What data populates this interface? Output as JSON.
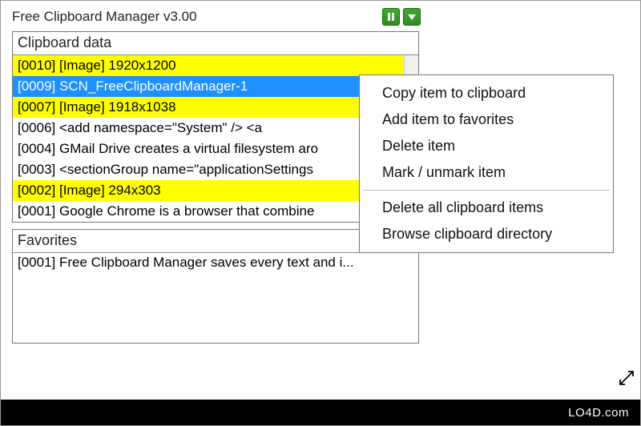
{
  "title": "Free Clipboard Manager v3.00",
  "toolbar": {
    "pause_icon": "pause",
    "menu_icon": "dropdown"
  },
  "clipboard_panel": {
    "header": "Clipboard data",
    "rows": [
      {
        "text": "[0010] [Image] 1920x1200",
        "style": "yellow"
      },
      {
        "text": "[0009] SCN_FreeClipboardManager-1",
        "style": "selected"
      },
      {
        "text": "[0007] [Image] 1918x1038",
        "style": "yellow"
      },
      {
        "text": "[0006] <add namespace=\"System\" />          <a",
        "style": ""
      },
      {
        "text": "[0004] GMail Drive creates a virtual filesystem aro",
        "style": ""
      },
      {
        "text": "[0003] <sectionGroup name=\"applicationSettings",
        "style": ""
      },
      {
        "text": "[0002] [Image] 294x303",
        "style": "yellow"
      },
      {
        "text": "[0001] Google Chrome is a browser that combine",
        "style": ""
      }
    ]
  },
  "favorites_panel": {
    "header": "Favorites",
    "rows": [
      {
        "text": "[0001] Free Clipboard Manager saves every text and i..."
      }
    ]
  },
  "context_menu": {
    "items": [
      "Copy item to clipboard",
      "Add item to favorites",
      "Delete item",
      "Mark / unmark item"
    ],
    "items2": [
      "Delete all clipboard items",
      "Browse clipboard directory"
    ]
  },
  "footer": {
    "brand": "LO4D.com"
  }
}
